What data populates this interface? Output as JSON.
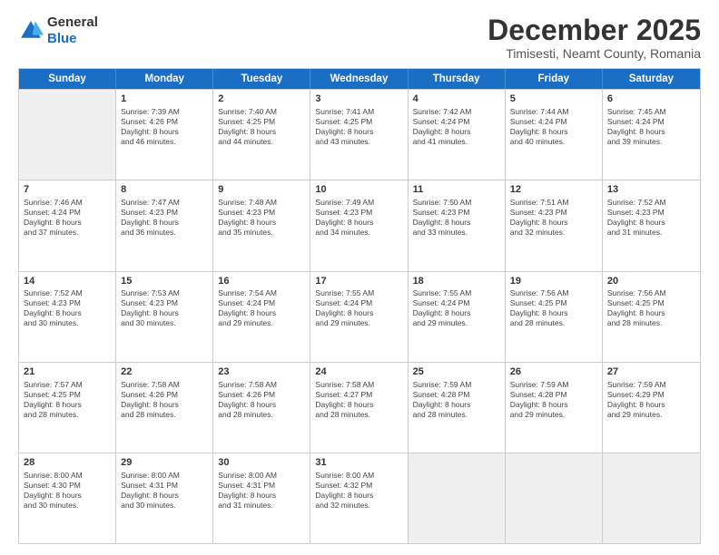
{
  "logo": {
    "line1": "General",
    "line2": "Blue"
  },
  "title": "December 2025",
  "subtitle": "Timisesti, Neamt County, Romania",
  "header_days": [
    "Sunday",
    "Monday",
    "Tuesday",
    "Wednesday",
    "Thursday",
    "Friday",
    "Saturday"
  ],
  "weeks": [
    [
      {
        "day": "",
        "shade": true,
        "lines": []
      },
      {
        "day": "1",
        "shade": false,
        "lines": [
          "Sunrise: 7:39 AM",
          "Sunset: 4:26 PM",
          "Daylight: 8 hours",
          "and 46 minutes."
        ]
      },
      {
        "day": "2",
        "shade": false,
        "lines": [
          "Sunrise: 7:40 AM",
          "Sunset: 4:25 PM",
          "Daylight: 8 hours",
          "and 44 minutes."
        ]
      },
      {
        "day": "3",
        "shade": false,
        "lines": [
          "Sunrise: 7:41 AM",
          "Sunset: 4:25 PM",
          "Daylight: 8 hours",
          "and 43 minutes."
        ]
      },
      {
        "day": "4",
        "shade": false,
        "lines": [
          "Sunrise: 7:42 AM",
          "Sunset: 4:24 PM",
          "Daylight: 8 hours",
          "and 41 minutes."
        ]
      },
      {
        "day": "5",
        "shade": false,
        "lines": [
          "Sunrise: 7:44 AM",
          "Sunset: 4:24 PM",
          "Daylight: 8 hours",
          "and 40 minutes."
        ]
      },
      {
        "day": "6",
        "shade": false,
        "lines": [
          "Sunrise: 7:45 AM",
          "Sunset: 4:24 PM",
          "Daylight: 8 hours",
          "and 39 minutes."
        ]
      }
    ],
    [
      {
        "day": "7",
        "shade": false,
        "lines": [
          "Sunrise: 7:46 AM",
          "Sunset: 4:24 PM",
          "Daylight: 8 hours",
          "and 37 minutes."
        ]
      },
      {
        "day": "8",
        "shade": false,
        "lines": [
          "Sunrise: 7:47 AM",
          "Sunset: 4:23 PM",
          "Daylight: 8 hours",
          "and 36 minutes."
        ]
      },
      {
        "day": "9",
        "shade": false,
        "lines": [
          "Sunrise: 7:48 AM",
          "Sunset: 4:23 PM",
          "Daylight: 8 hours",
          "and 35 minutes."
        ]
      },
      {
        "day": "10",
        "shade": false,
        "lines": [
          "Sunrise: 7:49 AM",
          "Sunset: 4:23 PM",
          "Daylight: 8 hours",
          "and 34 minutes."
        ]
      },
      {
        "day": "11",
        "shade": false,
        "lines": [
          "Sunrise: 7:50 AM",
          "Sunset: 4:23 PM",
          "Daylight: 8 hours",
          "and 33 minutes."
        ]
      },
      {
        "day": "12",
        "shade": false,
        "lines": [
          "Sunrise: 7:51 AM",
          "Sunset: 4:23 PM",
          "Daylight: 8 hours",
          "and 32 minutes."
        ]
      },
      {
        "day": "13",
        "shade": false,
        "lines": [
          "Sunrise: 7:52 AM",
          "Sunset: 4:23 PM",
          "Daylight: 8 hours",
          "and 31 minutes."
        ]
      }
    ],
    [
      {
        "day": "14",
        "shade": false,
        "lines": [
          "Sunrise: 7:52 AM",
          "Sunset: 4:23 PM",
          "Daylight: 8 hours",
          "and 30 minutes."
        ]
      },
      {
        "day": "15",
        "shade": false,
        "lines": [
          "Sunrise: 7:53 AM",
          "Sunset: 4:23 PM",
          "Daylight: 8 hours",
          "and 30 minutes."
        ]
      },
      {
        "day": "16",
        "shade": false,
        "lines": [
          "Sunrise: 7:54 AM",
          "Sunset: 4:24 PM",
          "Daylight: 8 hours",
          "and 29 minutes."
        ]
      },
      {
        "day": "17",
        "shade": false,
        "lines": [
          "Sunrise: 7:55 AM",
          "Sunset: 4:24 PM",
          "Daylight: 8 hours",
          "and 29 minutes."
        ]
      },
      {
        "day": "18",
        "shade": false,
        "lines": [
          "Sunrise: 7:55 AM",
          "Sunset: 4:24 PM",
          "Daylight: 8 hours",
          "and 29 minutes."
        ]
      },
      {
        "day": "19",
        "shade": false,
        "lines": [
          "Sunrise: 7:56 AM",
          "Sunset: 4:25 PM",
          "Daylight: 8 hours",
          "and 28 minutes."
        ]
      },
      {
        "day": "20",
        "shade": false,
        "lines": [
          "Sunrise: 7:56 AM",
          "Sunset: 4:25 PM",
          "Daylight: 8 hours",
          "and 28 minutes."
        ]
      }
    ],
    [
      {
        "day": "21",
        "shade": false,
        "lines": [
          "Sunrise: 7:57 AM",
          "Sunset: 4:25 PM",
          "Daylight: 8 hours",
          "and 28 minutes."
        ]
      },
      {
        "day": "22",
        "shade": false,
        "lines": [
          "Sunrise: 7:58 AM",
          "Sunset: 4:26 PM",
          "Daylight: 8 hours",
          "and 28 minutes."
        ]
      },
      {
        "day": "23",
        "shade": false,
        "lines": [
          "Sunrise: 7:58 AM",
          "Sunset: 4:26 PM",
          "Daylight: 8 hours",
          "and 28 minutes."
        ]
      },
      {
        "day": "24",
        "shade": false,
        "lines": [
          "Sunrise: 7:58 AM",
          "Sunset: 4:27 PM",
          "Daylight: 8 hours",
          "and 28 minutes."
        ]
      },
      {
        "day": "25",
        "shade": false,
        "lines": [
          "Sunrise: 7:59 AM",
          "Sunset: 4:28 PM",
          "Daylight: 8 hours",
          "and 28 minutes."
        ]
      },
      {
        "day": "26",
        "shade": false,
        "lines": [
          "Sunrise: 7:59 AM",
          "Sunset: 4:28 PM",
          "Daylight: 8 hours",
          "and 29 minutes."
        ]
      },
      {
        "day": "27",
        "shade": false,
        "lines": [
          "Sunrise: 7:59 AM",
          "Sunset: 4:29 PM",
          "Daylight: 8 hours",
          "and 29 minutes."
        ]
      }
    ],
    [
      {
        "day": "28",
        "shade": false,
        "lines": [
          "Sunrise: 8:00 AM",
          "Sunset: 4:30 PM",
          "Daylight: 8 hours",
          "and 30 minutes."
        ]
      },
      {
        "day": "29",
        "shade": false,
        "lines": [
          "Sunrise: 8:00 AM",
          "Sunset: 4:31 PM",
          "Daylight: 8 hours",
          "and 30 minutes."
        ]
      },
      {
        "day": "30",
        "shade": false,
        "lines": [
          "Sunrise: 8:00 AM",
          "Sunset: 4:31 PM",
          "Daylight: 8 hours",
          "and 31 minutes."
        ]
      },
      {
        "day": "31",
        "shade": false,
        "lines": [
          "Sunrise: 8:00 AM",
          "Sunset: 4:32 PM",
          "Daylight: 8 hours",
          "and 32 minutes."
        ]
      },
      {
        "day": "",
        "shade": true,
        "lines": []
      },
      {
        "day": "",
        "shade": true,
        "lines": []
      },
      {
        "day": "",
        "shade": true,
        "lines": []
      }
    ]
  ]
}
